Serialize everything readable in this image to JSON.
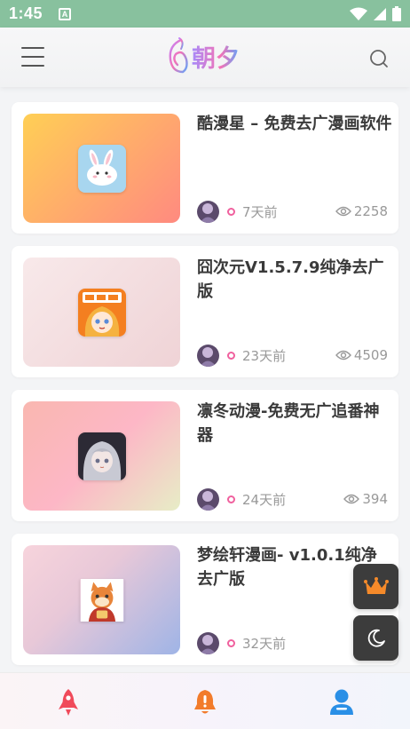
{
  "status_bar": {
    "time": "1:45",
    "notification_glyph": "A",
    "icons": [
      "wifi-icon",
      "signal-icon",
      "battery-icon"
    ]
  },
  "header": {
    "logo_text": "朝夕",
    "menu_icon": "menu-icon",
    "search_icon": "search-icon"
  },
  "posts": [
    {
      "title": "酷漫星 – 免费去广漫画软件",
      "time": "7天前",
      "views": "2258",
      "thumb_bg": "linear-gradient(135deg,#ffcf55,#ff8a80)",
      "icon": "rabbit"
    },
    {
      "title": "囧次元V1.5.7.9纯净去广版",
      "time": "23天前",
      "views": "4509",
      "thumb_bg": "linear-gradient(135deg,#f8e9ea,#efd3d6)",
      "icon": "anime-girl-orange"
    },
    {
      "title": "凛冬动漫-免费无广追番神器",
      "time": "24天前",
      "views": "394",
      "thumb_bg": "linear-gradient(135deg,#f9b7b0,#fdb7c6 50%,#e7edc6)",
      "icon": "anime-girl-silver"
    },
    {
      "title": "梦绘轩漫画- v1.0.1纯净去广版",
      "time": "32天前",
      "views": "",
      "thumb_bg": "linear-gradient(135deg,#f7d4dc,#e8c8d8 40%,#9fb4e6)",
      "icon": "fox-mascot"
    }
  ],
  "floating": {
    "vip_icon": "crown-icon",
    "theme_icon": "moon-icon"
  },
  "bottom_nav": [
    {
      "name": "rocket-icon",
      "color": "#f04a5a"
    },
    {
      "name": "bell-icon",
      "color": "#f27b2b"
    },
    {
      "name": "user-icon",
      "color": "#2a8fe6"
    }
  ],
  "colors": {
    "status_bar": "#88c19e",
    "accent_pink": "#f0609e",
    "fab_bg": "#3c3c3c"
  }
}
